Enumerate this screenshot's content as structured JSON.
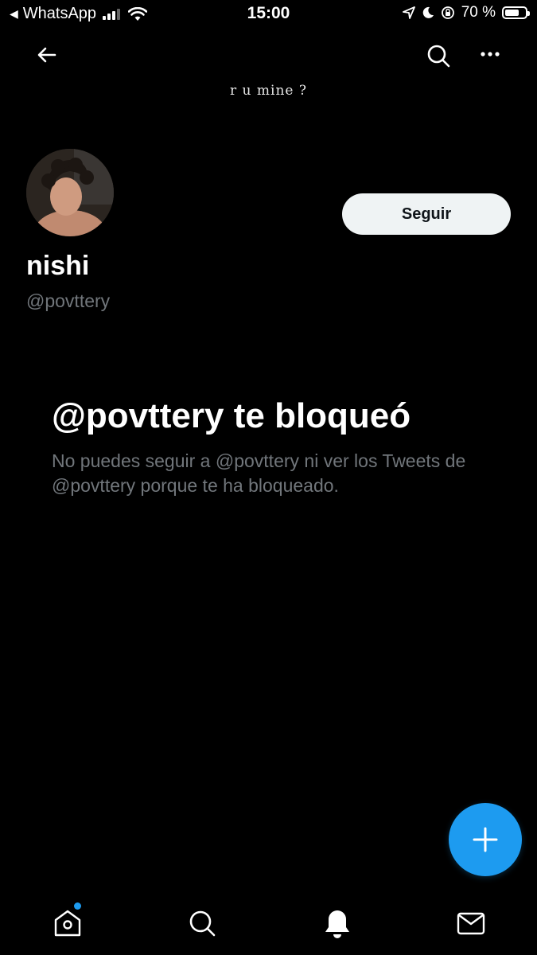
{
  "status_bar": {
    "back_app": "WhatsApp",
    "time": "15:00",
    "battery": "70 %",
    "battery_level": 0.7
  },
  "profile": {
    "banner_caption": "r u mine ?",
    "follow_label": "Seguir",
    "display_name": "nishi",
    "handle": "@povttery"
  },
  "blocked": {
    "title": "@povttery te bloqueó",
    "message": "No puedes seguir a @povttery ni ver los Tweets de @povttery porque te ha bloqueado."
  },
  "colors": {
    "accent": "#1d9bf0",
    "background": "#000000",
    "secondary_text": "#71767b",
    "button_bg": "#eff3f4"
  },
  "icons": {
    "top_nav": [
      "back-arrow-icon",
      "search-icon",
      "more-icon"
    ],
    "bottom_nav": [
      "home-icon",
      "search-icon",
      "notifications-bell-icon",
      "messages-envelope-icon"
    ],
    "fab": "plus-icon"
  }
}
